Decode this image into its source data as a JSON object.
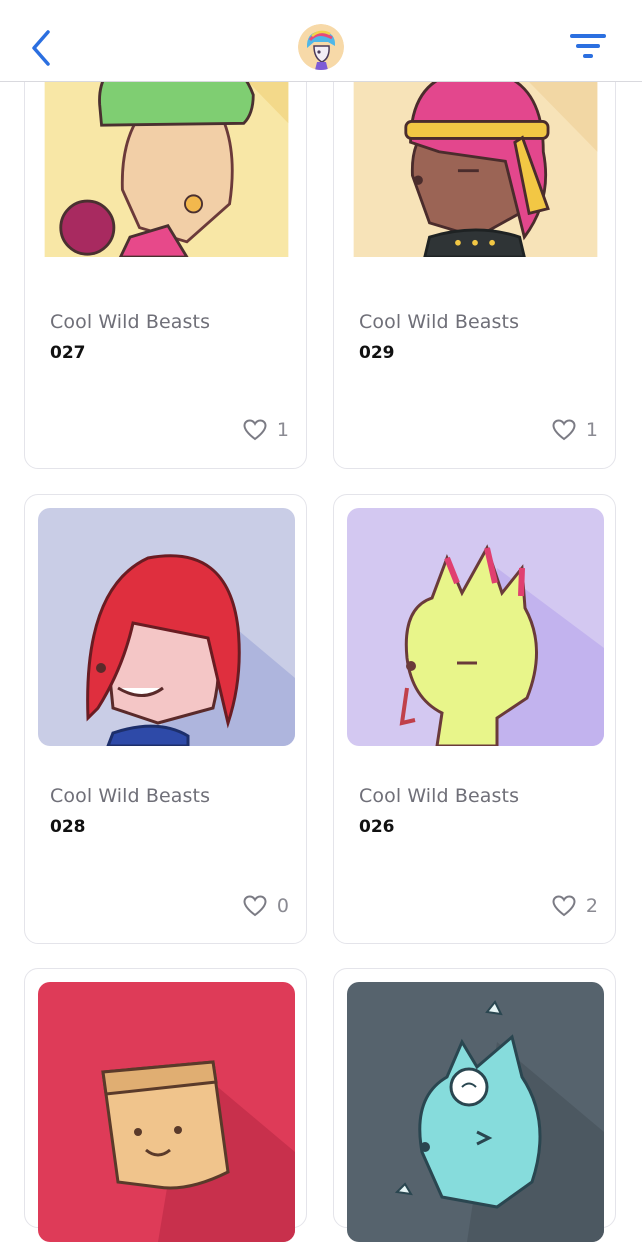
{
  "header": {
    "back_icon": "chevron-left-icon",
    "avatar_icon": "collection-avatar",
    "filter_icon": "filter-lines-icon",
    "accent_color": "#2b6fe0"
  },
  "cards": [
    {
      "collection": "Cool Wild Beasts",
      "token": "027",
      "likes": "1",
      "bg": "#f8e7a6"
    },
    {
      "collection": "Cool Wild Beasts",
      "token": "029",
      "likes": "1",
      "bg": "#f7e3b8"
    },
    {
      "collection": "Cool Wild Beasts",
      "token": "028",
      "likes": "0",
      "bg": "#c9cde6"
    },
    {
      "collection": "Cool Wild Beasts",
      "token": "026",
      "likes": "2",
      "bg": "#d3c8f1"
    },
    {
      "bg": "#de3b58"
    },
    {
      "bg": "#56636d"
    }
  ]
}
